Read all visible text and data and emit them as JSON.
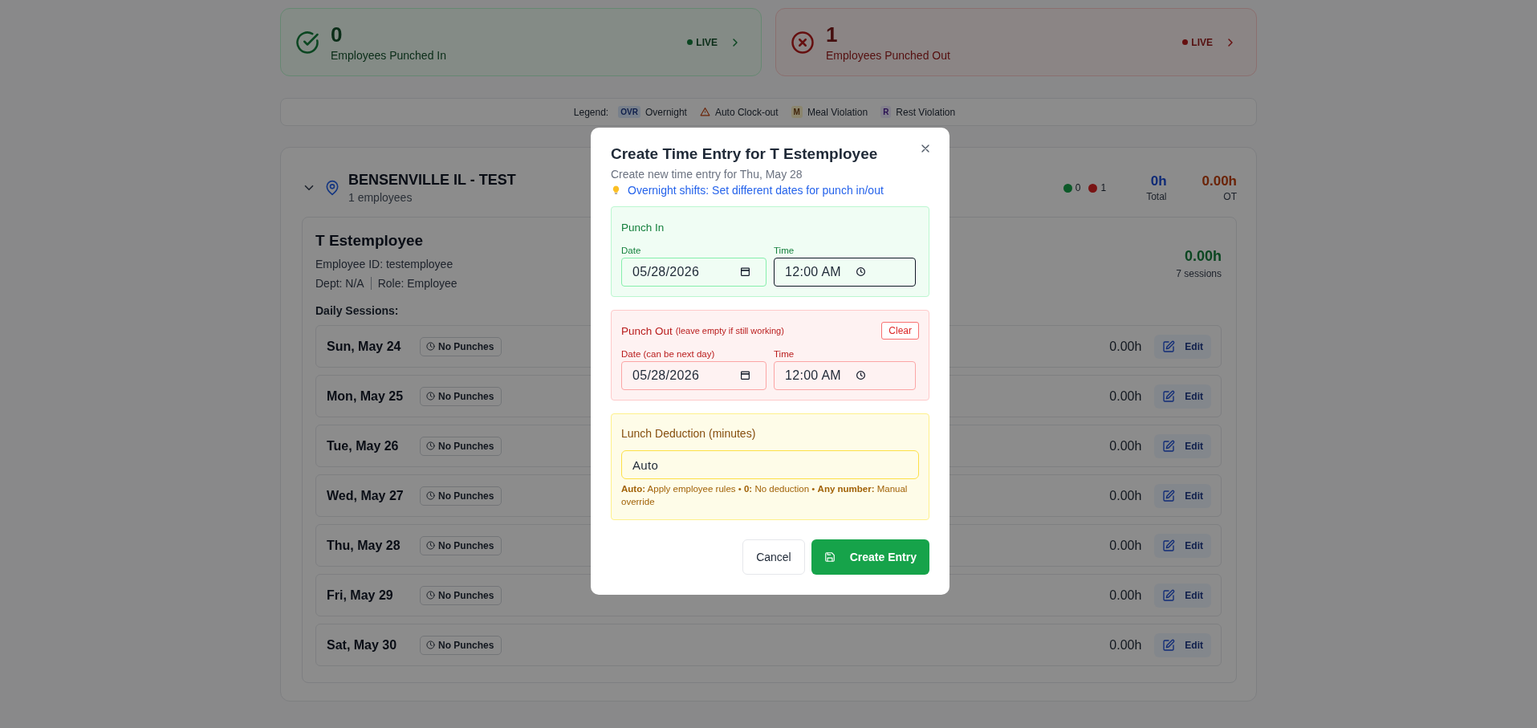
{
  "stats": [
    {
      "kind": "in",
      "count": "0",
      "label": "Employees Punched In",
      "status": "LIVE"
    },
    {
      "kind": "out",
      "count": "1",
      "label": "Employees Punched Out",
      "status": "LIVE"
    }
  ],
  "legend": {
    "label": "Legend:",
    "items": [
      {
        "kind": "overnight",
        "badge": "OVR",
        "label": "Overnight"
      },
      {
        "kind": "auto_clock_out",
        "label": "Auto Clock-out"
      },
      {
        "kind": "meal_violation",
        "badge": "M",
        "label": "Meal Violation"
      },
      {
        "kind": "rest_violation",
        "badge": "R",
        "label": "Rest Violation"
      }
    ]
  },
  "location": {
    "name": "BENSENVILLE IL - TEST",
    "subtitle": "1 employees",
    "expanded": true,
    "status_counts": [
      {
        "kind": "in",
        "count": "0"
      },
      {
        "kind": "out",
        "count": "1"
      }
    ],
    "total": "0h",
    "total_label": "Total",
    "ot": "0.00h",
    "ot_label": "OT"
  },
  "employee": {
    "name": "T Estemployee",
    "id_line": "Employee ID: testemployee",
    "dept": "Dept: N/A",
    "role": "Role: Employee",
    "hours": "0.00h",
    "sessions": "7 sessions",
    "sessions_heading": "Daily Sessions:",
    "days": [
      {
        "date": "Sun, May 24",
        "status": "No Punches",
        "hours": "0.00h",
        "action": "Edit"
      },
      {
        "date": "Mon, May 25",
        "status": "No Punches",
        "hours": "0.00h",
        "action": "Edit"
      },
      {
        "date": "Tue, May 26",
        "status": "No Punches",
        "hours": "0.00h",
        "action": "Edit"
      },
      {
        "date": "Wed, May 27",
        "status": "No Punches",
        "hours": "0.00h",
        "action": "Edit"
      },
      {
        "date": "Thu, May 28",
        "status": "No Punches",
        "hours": "0.00h",
        "action": "Edit"
      },
      {
        "date": "Fri, May 29",
        "status": "No Punches",
        "hours": "0.00h",
        "action": "Edit"
      },
      {
        "date": "Sat, May 30",
        "status": "No Punches",
        "hours": "0.00h",
        "action": "Edit"
      }
    ]
  },
  "modal": {
    "title": "Create Time Entry for T Estemployee",
    "subtitle": "Create new time entry for Thu, May 28",
    "tip": "Overnight shifts: Set different dates for punch in/out",
    "punch_in": {
      "heading": "Punch In",
      "date_label": "Date",
      "date_value": "05/28/2026",
      "time_label": "Time",
      "time_value": "12:00 AM",
      "time_focused": true
    },
    "punch_out": {
      "heading": "Punch Out",
      "note": "(leave empty if still working)",
      "clear": "Clear",
      "date_label": "Date (can be next day)",
      "date_value": "05/28/2026",
      "time_label": "Time",
      "time_value": "12:00 AM",
      "time_focused": false
    },
    "lunch": {
      "label": "Lunch Deduction (minutes)",
      "value": "Auto",
      "help": "**Auto:** Apply employee rules • **0:** No deduction • **Any number:** Manual override"
    },
    "cancel": "Cancel",
    "create": "Create Entry"
  }
}
